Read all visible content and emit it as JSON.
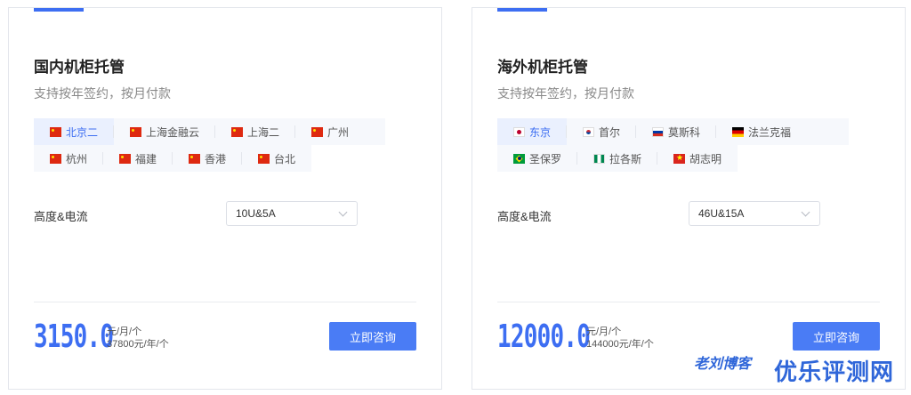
{
  "domestic": {
    "title": "国内机柜托管",
    "subtitle": "支持按年签约，按月付款",
    "regions_row1": [
      {
        "label": "北京二",
        "flag": "cn-flag-icon"
      },
      {
        "label": "上海金融云",
        "flag": "cn-flag-icon"
      },
      {
        "label": "上海二",
        "flag": "cn-flag-icon"
      },
      {
        "label": "广州",
        "flag": "cn-flag-icon"
      }
    ],
    "regions_row2": [
      {
        "label": "杭州",
        "flag": "cn-flag-icon"
      },
      {
        "label": "福建",
        "flag": "cn-flag-icon"
      },
      {
        "label": "香港",
        "flag": "cn-flag-icon"
      },
      {
        "label": "台北",
        "flag": "cn-flag-icon"
      }
    ],
    "active_region": "北京二",
    "spec_label": "高度&电流",
    "spec_value": "10U&5A",
    "price": "3150.0",
    "price_monthly_unit": "元/月/个",
    "price_yearly": "37800元/年/个",
    "button_label": "立即咨询"
  },
  "overseas": {
    "title": "海外机柜托管",
    "subtitle": "支持按年签约，按月付款",
    "regions_row1": [
      {
        "label": "东京",
        "flag": "jp-flag-icon"
      },
      {
        "label": "首尔",
        "flag": "kr-flag-icon"
      },
      {
        "label": "莫斯科",
        "flag": "ru-flag-icon"
      },
      {
        "label": "法兰克福",
        "flag": "de-flag-icon"
      }
    ],
    "regions_row2": [
      {
        "label": "圣保罗",
        "flag": "br-flag-icon"
      },
      {
        "label": "拉各斯",
        "flag": "ng-flag-icon"
      },
      {
        "label": "胡志明",
        "flag": "vn-flag-icon"
      }
    ],
    "active_region": "东京",
    "spec_label": "高度&电流",
    "spec_value": "46U&15A",
    "price": "12000.0",
    "price_monthly_unit": "元/月/个",
    "price_yearly": "144000元/年/个",
    "button_label": "立即咨询"
  },
  "watermark": {
    "blog": "老刘博客",
    "site": "优乐评测网"
  },
  "colors": {
    "accent": "#3d6ef2",
    "button": "#4a7cf5",
    "active_tab_bg": "#eaf0fe"
  }
}
